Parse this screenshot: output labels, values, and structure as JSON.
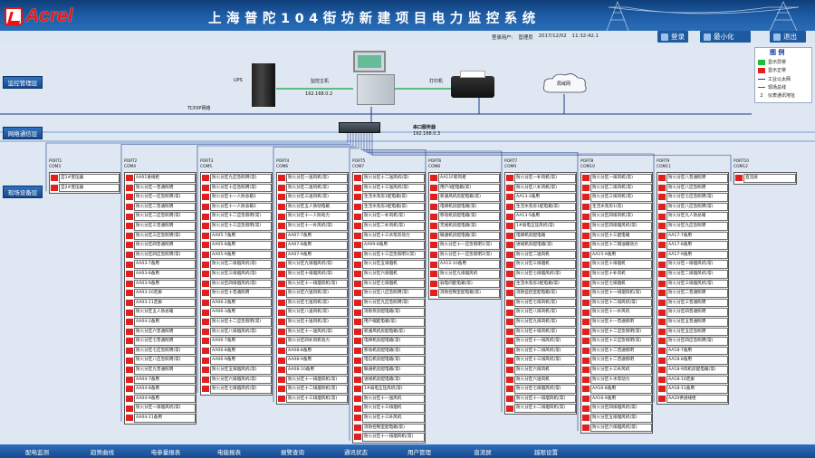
{
  "app": {
    "logo_text": "Acrel",
    "title": "上海普陀104街坊新建项目电力监控系统"
  },
  "user": {
    "label": "登录用户:",
    "name": "管理员",
    "date": "2017/12/02",
    "time": "11:32:42.1"
  },
  "top_buttons": [
    {
      "label": "登录",
      "icon": "login-icon"
    },
    {
      "label": "最小化",
      "icon": "minimize-icon"
    },
    {
      "label": "退出",
      "icon": "exit-icon"
    }
  ],
  "layers": {
    "monitor": "监控管理层",
    "network": "网络通信层",
    "field": "现场设备层"
  },
  "equipment": {
    "ups": "UPS",
    "host": "监控主机",
    "host_ip": "192.168.0.2",
    "printer": "打印机",
    "lan": "局域网",
    "tcpip": "TCP/IP网络",
    "server": "串口服务器",
    "server_ip": "192.168.0.3"
  },
  "legend": {
    "title": "图 例",
    "items": [
      {
        "label": "显示异常",
        "color": "#16c13a"
      },
      {
        "label": "显示正常",
        "color": "#e01f1f"
      },
      {
        "label": "工业以太网"
      },
      {
        "label": "现场总线"
      },
      {
        "label": "仪表通讯地址",
        "prefix": "2"
      }
    ]
  },
  "ports": [
    {
      "port": "PORT1",
      "com": "COM3",
      "devices": [
        "宜1#变压器",
        "宜2#变压器"
      ]
    },
    {
      "port": "PORT2",
      "com": "COM4",
      "devices": [
        "AA01进线柜",
        "防火分区一普通照明",
        "防火分区一应急照明(常)",
        "防火分区二普通照明",
        "防火分区二应急照明(常)",
        "防火分区三普通照明",
        "防火分区三应急照明(常)",
        "防火分区四普通照明",
        "防火分区四应急照明(常)",
        "AA03-7备用",
        "AA03-8备用",
        "AA03-9备用",
        "AA03-10走廊",
        "AA03-11走廊",
        "防火分区五人防总箱",
        "AA04-2备用",
        "防火分区六普通照明",
        "防火分区七普通照明",
        "防火分区七应急照明(常)",
        "防火分区八应急照明(常)",
        "防火分区九普通照明",
        "AA04-7备用",
        "AA04-8备用",
        "AA04-9备用",
        "防火分区一排烟风机(常)",
        "AA04-11备用"
      ]
    },
    {
      "port": "PORT3",
      "com": "COM5",
      "devices": [
        "防火分区九应急照明(常)",
        "防火分区十应急照明(常)",
        "防火分区十一人防总箱1",
        "防火分区十一人防总箱2",
        "防火分区十二应急照明(常)",
        "防火分区十三应急照明(常)",
        "AA05-7备用",
        "AA05-8备用",
        "AA05-9备用",
        "防火分区二排烟风机(常)",
        "防火分区三排烟风机(常)",
        "防火分区四排烟风机(常)",
        "防火分区十普通照明",
        "AA06-2备用",
        "AA06-3备用",
        "防火分区十二应急照明(常)",
        "防火分区八排烟风机(常)",
        "AA06-7备用",
        "AA06-8备用",
        "AA06-9备用",
        "防火分区五排烟风机(常)",
        "防火分区六排烟风机(常)",
        "防火分区七排烟风机(常)"
      ]
    },
    {
      "port": "PORT4",
      "com": "COM6",
      "devices": [
        "防火分区一送风机(常)",
        "防火分区二送风机(常)",
        "防火分区三送风机(常)",
        "防火分区五人防动电箱",
        "防火分区十一人防动力",
        "防火分区十一补风机(常)",
        "AA07-7备用",
        "AA07-8备用",
        "AA07-9备用",
        "防火分区九排烟风机(常)",
        "防火分区十排烟风机(常)",
        "防火分区十一排烟风机(常)",
        "防火分区六送风机(常)",
        "防火分区七送风机(常)",
        "防火分区八送风机(常)",
        "防火分区十送风机(常)",
        "防火分区十一送风机(常)",
        "防火分区四补风机动力",
        "AA08-8备用",
        "AA08-9备用",
        "AA08-10备用",
        "防火分区十一排烟风机(常)",
        "防火分区十二排烟风机(常)",
        "防火分区十三排烟风机(常)"
      ]
    },
    {
      "port": "PORT5",
      "com": "COM7",
      "devices": [
        "防火分区十二送风机(常)",
        "防火分区十三送风机(常)",
        "生活水泵房1配电箱(常)",
        "生活水泵房2配电箱(常)",
        "防火分区一补风机(常)",
        "防火分区二补风机(常)",
        "防火分区十三水泵房动力",
        "AA09-8备用",
        "防火分区十三应急照明1(常)",
        "防火分区五排烟机",
        "防火分区六排烟机",
        "防火分区七排烟机",
        "防火分区八应急照明(常)",
        "防火分区九应急照明(常)",
        "消防泵房配电箱(常)",
        "用户端配电箱(常)",
        "新通风机房配电箱(常)",
        "电梯机房配电箱(常)",
        "移动机房配电箱(常)",
        "电信机房配电箱(常)",
        "联通机房配电箱(常)",
        "进线机房配电箱(常)",
        "1#弱电正压风机(常)",
        "防火分区十一送风机",
        "防火分区十三排烟机",
        "防火分区十三补风机",
        "消防控制室配电箱(常)",
        "防火分区十一排烟风机(常)"
      ]
    },
    {
      "port": "PORT6",
      "com": "COM8",
      "devices": [
        "AA11F新风柜",
        "用户4配电箱(常)",
        "新通风机房配电箱(常)",
        "电梯机房配电箱(常)",
        "移动机房配电箱(常)",
        "无线机房配电箱(常)",
        "联通机房配电箱(常)",
        "防火分区十一应急照明1(常)",
        "防火分区十一应急照明2(常)",
        "AA12-10备用",
        "防火分区九排烟风机",
        "弱电间配电箱(常)",
        "消防控制室配电箱(常)"
      ]
    },
    {
      "port": "PORT7",
      "com": "COM9",
      "devices": [
        "防火分区一补风机(常)",
        "防火分区八补风机(常)",
        "AA13-3备用",
        "生活水泵房1配电箱(常)",
        "AA13-5备用",
        "1#弱电正压风机(常)",
        "电梯机房配电箱",
        "进线机房配电箱(常)",
        "防火分区二送风机",
        "防火分区三排烟机",
        "防火分区七排烟风机(常)",
        "生活水泵房2配电箱(常)",
        "消防监控室配电箱(常)",
        "防火分区七排风机(常)",
        "防火分区八排风机(常)",
        "防火分区九排风机(常)",
        "防火分区十排风机(常)",
        "防火分区十一排风机(常)",
        "防火分区十二排风机(常)",
        "防火分区十三排风机(常)",
        "防火分区六排风机",
        "防火分区六送风机",
        "防火分区七排烟风机(常)",
        "防火分区十一排烟风机(常)",
        "防火分区十二排烟风机(常)"
      ]
    },
    {
      "port": "PORT8",
      "com": "COM10",
      "devices": [
        "防火分区一排风机(常)",
        "防火分区二排风机(常)",
        "防火分区三排风机(常)",
        "生活水泵房1(常)",
        "防火分区四排风机(常)",
        "防火分区四排烟风机(常)",
        "防火分区十三配电箱",
        "防火分区十二隔油箱动力",
        "AA15-9备用",
        "防火分区十排烟机",
        "防火分区十补风机",
        "防火分区七排烟机",
        "防火分区十一排烟风机(常)",
        "防火分区十二排风机(常)",
        "防火分区十一补风机",
        "防火分区十一普通照明",
        "防火分区十二应急照明(常)",
        "防火分区十三应急照明(常)",
        "防火分区十二普通照明",
        "防火分区十二普通照明",
        "防火分区十三补风机",
        "防火分区十水泵动力",
        "AA16-8备用",
        "AA16-9备用",
        "防火分区四排烟风机(常)",
        "防火分区五排烟风机(常)",
        "防火分区六排烟风机(常)"
      ]
    },
    {
      "port": "PORT9",
      "com": "COM11",
      "devices": [
        "防火分区八普通照明",
        "防火分区八应急照明",
        "防火分区七应急照明(常)",
        "防火分区八应急照明(常)",
        "防火分区九人防总箱",
        "防火分区九应急照明",
        "AA17-7备用",
        "AA17-8备用",
        "AA17-9备用",
        "防火分区一排烟风机(常)",
        "防火分区二排烟风机(常)",
        "防火分区三排烟风机(常)",
        "防火分区二普通照明",
        "防火分区三普通照明",
        "防火分区四普通照明",
        "防火分区五普通照明",
        "防火分区五应急照明",
        "防火分区四应急照明(常)",
        "AA18-7备用",
        "AA18-8备用",
        "AA18-9风机房配电箱(常)",
        "AA18-10走廊",
        "AA18-11备用",
        "AA20供进线柜"
      ]
    },
    {
      "port": "PORT10",
      "com": "COM12",
      "devices": [
        "直流屏"
      ]
    }
  ],
  "bottom_tabs": [
    "配电监测",
    "趋势曲线",
    "电参量报表",
    "电能报表",
    "报警查询",
    "通讯状态",
    "用户管理",
    "直流屏",
    "越限设置"
  ]
}
